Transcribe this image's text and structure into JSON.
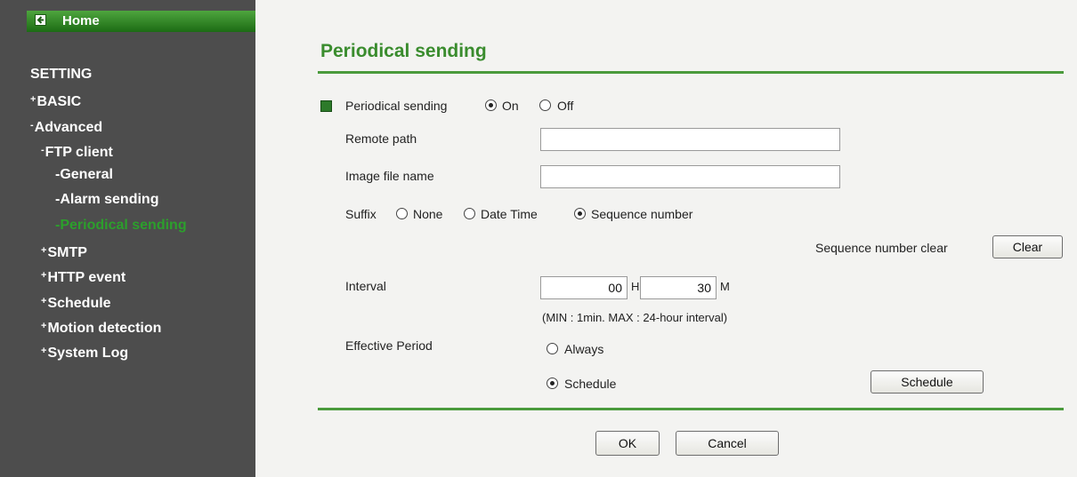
{
  "sidebar": {
    "home_label": "Home",
    "items": [
      {
        "label": "SETTING",
        "prefix": ""
      },
      {
        "label": "BASIC",
        "prefix": "+"
      },
      {
        "label": "Advanced",
        "prefix": "-"
      },
      {
        "label": "FTP client",
        "prefix": "-"
      },
      {
        "label": "General",
        "prefix": "-"
      },
      {
        "label": "Alarm sending",
        "prefix": "-"
      },
      {
        "label": "Periodical sending",
        "prefix": "-"
      },
      {
        "label": "SMTP",
        "prefix": "+"
      },
      {
        "label": "HTTP event",
        "prefix": "+"
      },
      {
        "label": "Schedule",
        "prefix": "+"
      },
      {
        "label": "Motion detection",
        "prefix": "+"
      },
      {
        "label": "System Log",
        "prefix": "+"
      }
    ]
  },
  "page": {
    "title": "Periodical sending"
  },
  "form": {
    "periodical_label": "Periodical sending",
    "on_label": "On",
    "off_label": "Off",
    "periodical_value": "On",
    "remote_path_label": "Remote path",
    "remote_path_value": "",
    "image_file_label": "Image file name",
    "image_file_value": "",
    "suffix_label": "Suffix",
    "suffix_options": [
      "None",
      "Date Time",
      "Sequence number"
    ],
    "suffix_value": "Sequence number",
    "seq_clear_label": "Sequence number clear",
    "clear_button": "Clear",
    "interval_label": "Interval",
    "interval_hours": "00",
    "hours_unit": "H",
    "interval_minutes": "30",
    "minutes_unit": "M",
    "interval_hint": "(MIN : 1min. MAX : 24-hour interval)",
    "effective_label": "Effective Period",
    "always_label": "Always",
    "schedule_label": "Schedule",
    "effective_value": "Schedule",
    "schedule_button": "Schedule"
  },
  "actions": {
    "ok": "OK",
    "cancel": "Cancel"
  },
  "colors": {
    "sidebar_bg": "#4d4d4d",
    "accent_green": "#3a8c2e",
    "active_menu": "#2c9f2c",
    "content_bg": "#f3f3f1"
  },
  "icons": {
    "home": "arrow-left-icon",
    "bullet": "green-square-icon"
  }
}
